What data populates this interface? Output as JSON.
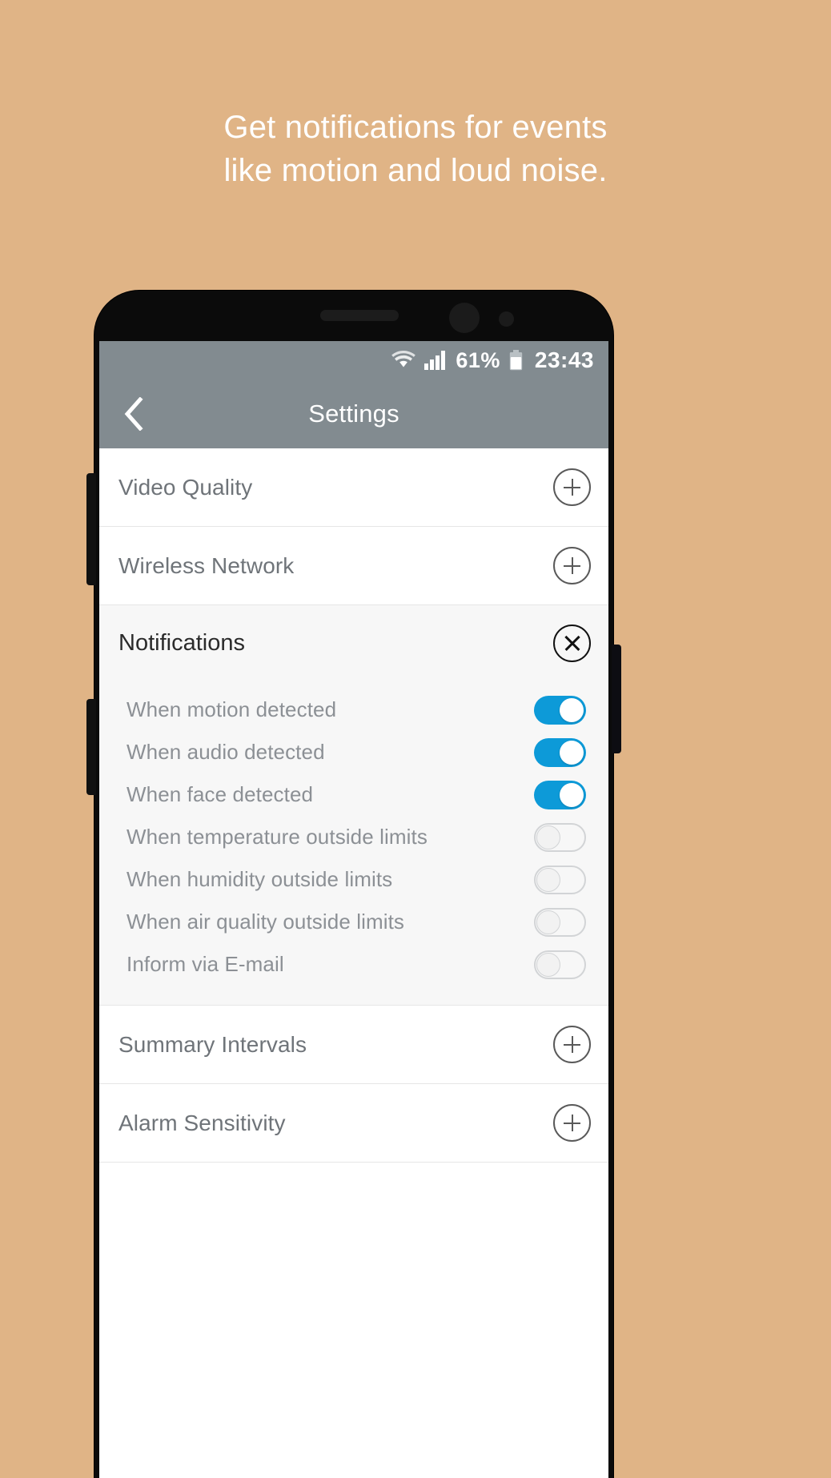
{
  "headline": {
    "line1": "Get notifications for events",
    "line2": "like motion and loud noise."
  },
  "colors": {
    "background": "#e0b486",
    "appbar": "#828b90",
    "toggle_on": "#0d9ad8",
    "toggle_off_border": "#d2d4d6",
    "section_background": "#f7f7f7"
  },
  "statusbar": {
    "wifi_icon": "wifi-icon",
    "signal_icon": "cellular-signal-icon",
    "battery_percent": "61%",
    "battery_icon": "battery-icon",
    "clock": "23:43"
  },
  "appbar": {
    "back_icon": "chevron-left-icon",
    "title": "Settings"
  },
  "settings": {
    "rows_top": [
      {
        "label": "Video Quality",
        "action_icon": "plus-circle-icon"
      },
      {
        "label": "Wireless Network",
        "action_icon": "plus-circle-icon"
      }
    ],
    "expanded_section": {
      "title": "Notifications",
      "action_icon": "close-circle-icon",
      "items": [
        {
          "label": "When motion detected",
          "state": "on"
        },
        {
          "label": "When audio detected",
          "state": "on"
        },
        {
          "label": "When face detected",
          "state": "on"
        },
        {
          "label": "When temperature outside limits",
          "state": "off"
        },
        {
          "label": "When humidity outside limits",
          "state": "off"
        },
        {
          "label": "When air quality outside limits",
          "state": "off"
        },
        {
          "label": "Inform via E-mail",
          "state": "off"
        }
      ]
    },
    "rows_bottom": [
      {
        "label": "Summary Intervals",
        "action_icon": "plus-circle-icon"
      },
      {
        "label": "Alarm Sensitivity",
        "action_icon": "plus-circle-icon"
      }
    ]
  }
}
